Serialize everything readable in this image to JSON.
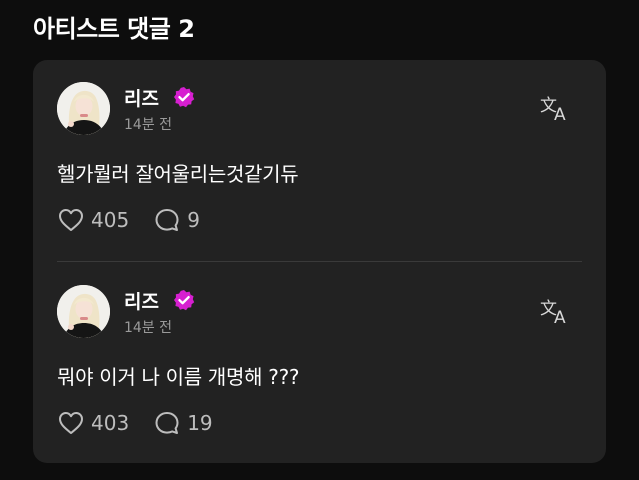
{
  "section": {
    "title": "아티스트 댓글 2"
  },
  "colors": {
    "badge": "#d61fd0",
    "background": "#0d0d0d",
    "card": "#222222"
  },
  "comments": [
    {
      "author": "리즈",
      "time": "14분 전",
      "text": "헬가뭘러 잘어울리는것같기듀",
      "likes": "405",
      "replies": "9",
      "icons": {
        "like": "heart-icon",
        "reply": "speech-bubble-icon",
        "translate": "translate-icon",
        "badge": "verified-badge-icon"
      }
    },
    {
      "author": "리즈",
      "time": "14분 전",
      "text": "뭐야 이거 나 이름 개명해 ???",
      "likes": "403",
      "replies": "19",
      "icons": {
        "like": "heart-icon",
        "reply": "speech-bubble-icon",
        "translate": "translate-icon",
        "badge": "verified-badge-icon"
      }
    }
  ]
}
